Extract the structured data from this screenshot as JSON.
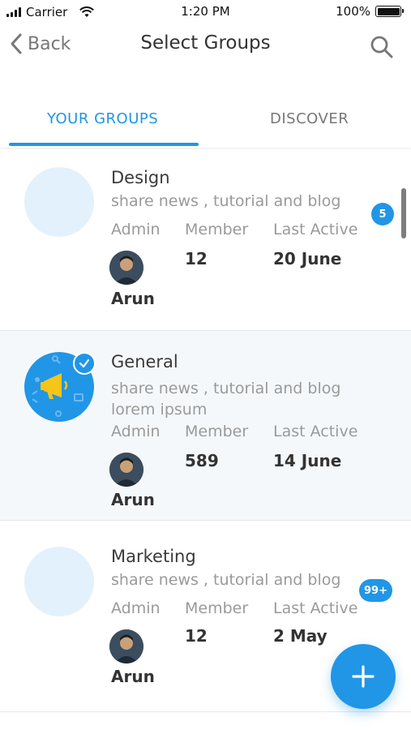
{
  "status_bar": {
    "carrier": "Carrier",
    "time": "1:20 PM",
    "battery": "100%"
  },
  "nav": {
    "back_label": "Back",
    "title": "Select Groups"
  },
  "tabs": [
    {
      "label": "YOUR GROUPS",
      "active": true
    },
    {
      "label": "DISCOVER",
      "active": false
    }
  ],
  "columns": {
    "admin": "Admin",
    "member": "Member",
    "last_active": "Last Active"
  },
  "groups": [
    {
      "name": "Design",
      "description": "share news , tutorial and blog",
      "admin": "Arun",
      "members": "12",
      "last_active": "20 June",
      "badge": "5",
      "selected": false
    },
    {
      "name": "General",
      "description": "share news , tutorial and blog lorem ipsum",
      "admin": "Arun",
      "members": "589",
      "last_active": "14 June",
      "badge": "",
      "selected": true
    },
    {
      "name": "Marketing",
      "description": "share news , tutorial and blog",
      "admin": "Arun",
      "members": "12",
      "last_active": "2 May",
      "badge": "99+",
      "selected": false
    }
  ],
  "colors": {
    "accent": "#2196e6",
    "avatar_placeholder": "#e3f1fc",
    "megaphone": "#f5c518"
  },
  "icons": {
    "back": "chevron-left-icon",
    "search": "search-icon",
    "check": "check-icon",
    "add": "plus-icon",
    "megaphone": "megaphone-icon"
  }
}
